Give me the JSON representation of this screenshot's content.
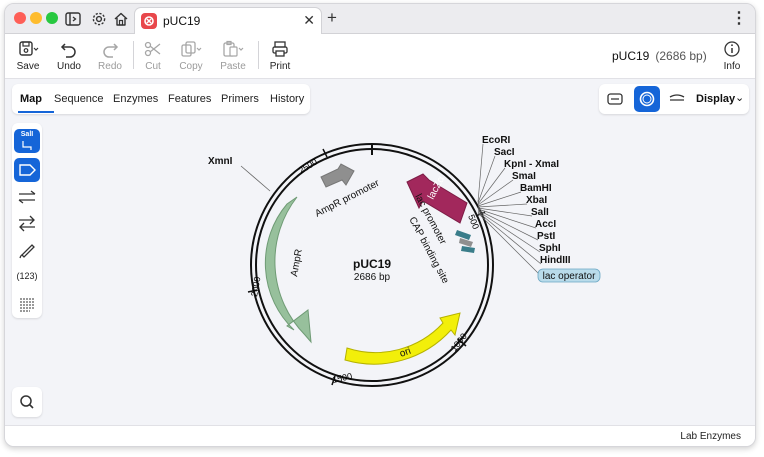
{
  "titlebar": {
    "tab_title": "pUC19",
    "tab_close": "✕",
    "new_tab": "+",
    "more": "⋮"
  },
  "toolbar": {
    "save_label": "Save",
    "undo_label": "Undo",
    "redo_label": "Redo",
    "cut_label": "Cut",
    "copy_label": "Copy",
    "paste_label": "Paste",
    "print_label": "Print",
    "info_label": "Info",
    "sequence_name": "pUC19",
    "sequence_length": "(2686 bp)"
  },
  "view_tabs": [
    "Map",
    "Sequence",
    "Enzymes",
    "Features",
    "Primers",
    "History"
  ],
  "active_view": "Map",
  "display_menu": {
    "label": "Display",
    "chevron": "⌄"
  },
  "left_tools": {
    "enzyme_tool_text": "SalI",
    "numbers_text": "(123)"
  },
  "map": {
    "name": "pUC19",
    "length_label": "2686 bp",
    "ticks": [
      "500",
      "1000",
      "1500",
      "2000",
      "2500"
    ],
    "features": [
      {
        "name": "AmpR promoter",
        "color": "#8f8f8f"
      },
      {
        "name": "AmpR",
        "color": "#97c09c"
      },
      {
        "name": "lacZα",
        "color": "#a2285c"
      },
      {
        "name": "lac promoter",
        "color": "#8f8f8f"
      },
      {
        "name": "CAP binding site",
        "color": "#3a7d8a"
      },
      {
        "name": "ori",
        "color": "#f2ef0a"
      }
    ],
    "enzymes_right": [
      "EcoRI",
      "SacI",
      "KpnI - XmaI",
      "SmaI",
      "BamHI",
      "XbaI",
      "SalI",
      "AccI",
      "PstI",
      "SphI",
      "HindIII"
    ],
    "enzymes_left": [
      "XmnI"
    ],
    "highlighted_label": "lac operator"
  },
  "status": {
    "enzyme_set": "Lab Enzymes"
  }
}
